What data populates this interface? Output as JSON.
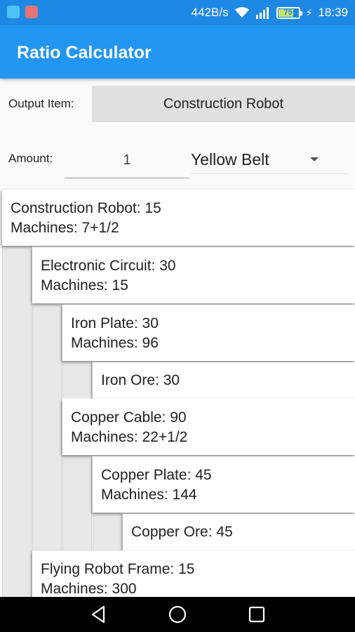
{
  "status_bar": {
    "speed": "442B/s",
    "battery": "75",
    "time": "18:39"
  },
  "app": {
    "title": "Ratio Calculator"
  },
  "form": {
    "output_label": "Output Item:",
    "output_value": "Construction Robot",
    "amount_label": "Amount:",
    "amount_value": "1",
    "belt_value": "Yellow Belt"
  },
  "tree": [
    {
      "name": "Construction Robot: 15",
      "machines": "Machines: 7+1/2"
    },
    {
      "name": "Electronic Circuit: 30",
      "machines": "Machines: 15"
    },
    {
      "name": "Iron Plate: 30",
      "machines": "Machines: 96"
    },
    {
      "name": "Iron Ore: 30"
    },
    {
      "name": "Copper Cable: 90",
      "machines": "Machines: 22+1/2"
    },
    {
      "name": "Copper Plate: 45",
      "machines": "Machines: 144"
    },
    {
      "name": "Copper Ore: 45"
    },
    {
      "name": "Flying Robot Frame: 15",
      "machines": "Machines: 300"
    }
  ],
  "icons": [
    "app-icon",
    "app-icon",
    "wifi-icon",
    "signal-icon",
    "battery-icon",
    "charging-icon",
    "back-icon",
    "home-icon",
    "recents-icon"
  ],
  "colors": {
    "status_bar": "#1e88e5",
    "app_bar": "#2196f3",
    "button": "#e0e0e0"
  }
}
